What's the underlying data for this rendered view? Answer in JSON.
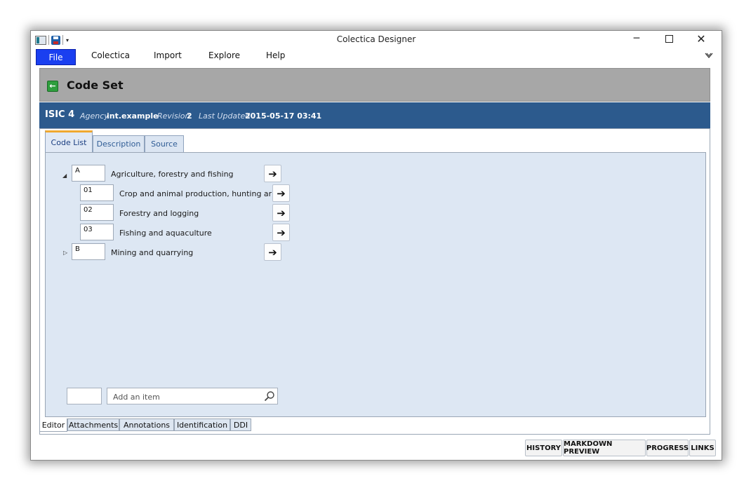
{
  "window": {
    "title": "Colectica Designer",
    "minimize_glyph": "─",
    "close_glyph": "✕"
  },
  "menu": {
    "file": "File",
    "items": [
      "Colectica",
      "Import",
      "Explore",
      "Help"
    ]
  },
  "page": {
    "title": "Code Set",
    "back_icon": "back-arrow-icon"
  },
  "info": {
    "name": "ISIC 4",
    "agency_label": "Agency",
    "agency": "int.example",
    "revision_label": "Revision",
    "revision": "2",
    "updated_label": "Last Updated",
    "updated": "2015-05-17 03:41"
  },
  "tabs": [
    "Code List",
    "Description",
    "Source"
  ],
  "codes": [
    {
      "code": "A",
      "label": "Agriculture, forestry and fishing",
      "level": 0,
      "expander": "◢"
    },
    {
      "code": "01",
      "label": "Crop and animal production, hunting and",
      "level": 1
    },
    {
      "code": "02",
      "label": "Forestry and logging",
      "level": 1
    },
    {
      "code": "03",
      "label": "Fishing and aquaculture",
      "level": 1
    },
    {
      "code": "B",
      "label": "Mining and quarrying",
      "level": 0,
      "expander": "▷"
    }
  ],
  "add_item": {
    "placeholder": "Add an item"
  },
  "bottom_tabs": [
    "Editor",
    "Attachments",
    "Annotations",
    "Identification",
    "DDI"
  ],
  "status_buttons": [
    "HISTORY",
    "MARKDOWN PREVIEW",
    "PROGRESS",
    "LINKS"
  ],
  "colors": {
    "file_menu": "#1a3ff0",
    "header_gray": "#a7a7a7",
    "info_bar": "#2c5a8d",
    "panel_bg": "#dde7f3",
    "active_tab_accent": "#f0a830"
  }
}
